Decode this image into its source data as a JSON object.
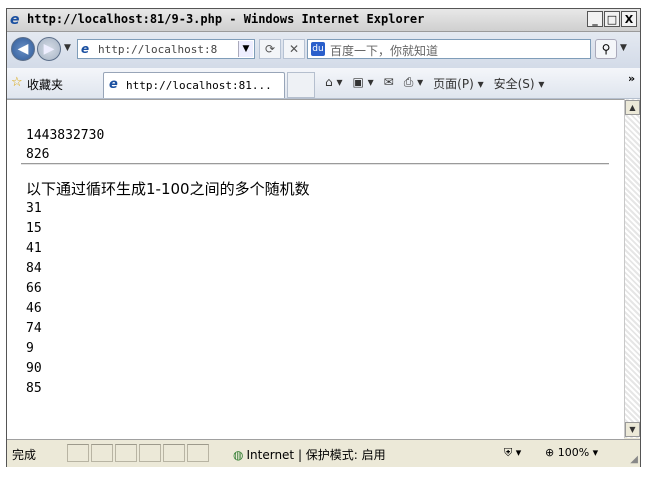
{
  "window": {
    "title": "http://localhost:81/9-3.php - Windows Internet Explorer",
    "min": "_",
    "max": "□",
    "close": "X"
  },
  "toolbar": {
    "address": "http://localhost:8",
    "search_placeholder": "百度一下，你就知道"
  },
  "favorites": {
    "label": "收藏夹",
    "tab_title": "http://localhost:81...",
    "page_menu": "页面(P)",
    "safety_menu": "安全(S)"
  },
  "content": {
    "number1": "1443832730",
    "number2": "826",
    "heading": "以下通过循环生成1-100之间的多个随机数",
    "randoms": [
      "31",
      "15",
      "41",
      "84",
      "66",
      "46",
      "74",
      "9",
      "90",
      "85"
    ]
  },
  "status": {
    "text": "完成",
    "zone": "Internet | 保护模式: 启用",
    "zoom": "100%"
  }
}
